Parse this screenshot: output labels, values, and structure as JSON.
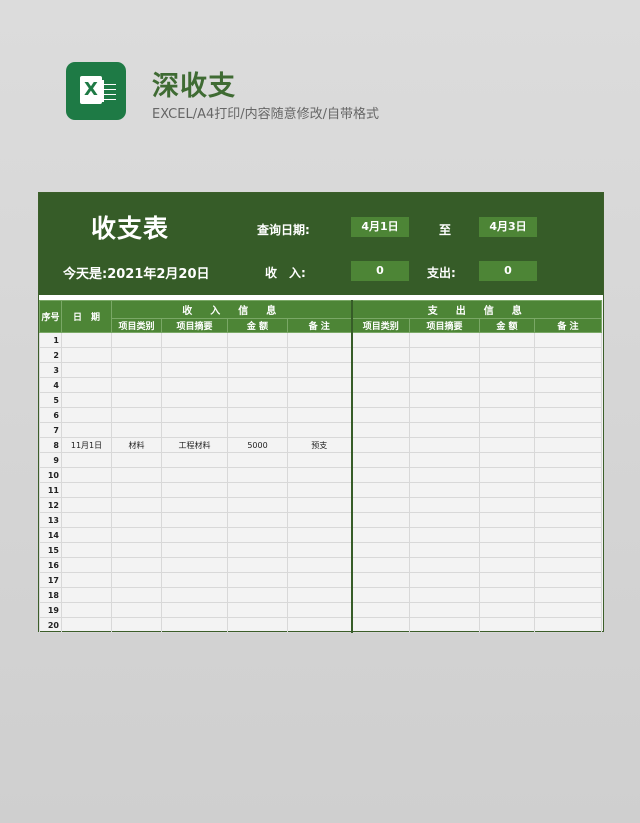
{
  "page": {
    "title": "深收支",
    "subtitle": "EXCEL/A4打印/内容随意修改/自带格式",
    "logo_letter": "X"
  },
  "sheet": {
    "heading": "收支表",
    "query_label": "查询日期:",
    "start_date": "4月1日",
    "to_label": "至",
    "end_date": "4月3日",
    "today_label": "今天是:2021年2月20日",
    "income_label": "收　入:",
    "income_value": "0",
    "expense_label": "支出:",
    "expense_value": "0",
    "table": {
      "col_seq": "序号",
      "col_date": "日　期",
      "income_group": "收　入　信　息",
      "expense_group": "支　出　信　息",
      "income_cols": [
        "项目类别",
        "项目摘要",
        "金 额",
        "备 注"
      ],
      "expense_cols": [
        "项目类别",
        "项目摘要",
        "金 额",
        "备 注"
      ],
      "rows": [
        {
          "n": "1",
          "date": "",
          "cat": "",
          "sum": "",
          "amt": "",
          "note": ""
        },
        {
          "n": "2",
          "date": "",
          "cat": "",
          "sum": "",
          "amt": "",
          "note": ""
        },
        {
          "n": "3",
          "date": "",
          "cat": "",
          "sum": "",
          "amt": "",
          "note": ""
        },
        {
          "n": "4",
          "date": "",
          "cat": "",
          "sum": "",
          "amt": "",
          "note": ""
        },
        {
          "n": "5",
          "date": "",
          "cat": "",
          "sum": "",
          "amt": "",
          "note": ""
        },
        {
          "n": "6",
          "date": "",
          "cat": "",
          "sum": "",
          "amt": "",
          "note": ""
        },
        {
          "n": "7",
          "date": "",
          "cat": "",
          "sum": "",
          "amt": "",
          "note": ""
        },
        {
          "n": "8",
          "date": "11月1日",
          "cat": "材料",
          "sum": "工程材料",
          "amt": "5000",
          "note": "预支"
        },
        {
          "n": "9",
          "date": "",
          "cat": "",
          "sum": "",
          "amt": "",
          "note": ""
        },
        {
          "n": "10",
          "date": "",
          "cat": "",
          "sum": "",
          "amt": "",
          "note": ""
        },
        {
          "n": "11",
          "date": "",
          "cat": "",
          "sum": "",
          "amt": "",
          "note": ""
        },
        {
          "n": "12",
          "date": "",
          "cat": "",
          "sum": "",
          "amt": "",
          "note": ""
        },
        {
          "n": "13",
          "date": "",
          "cat": "",
          "sum": "",
          "amt": "",
          "note": ""
        },
        {
          "n": "14",
          "date": "",
          "cat": "",
          "sum": "",
          "amt": "",
          "note": ""
        },
        {
          "n": "15",
          "date": "",
          "cat": "",
          "sum": "",
          "amt": "",
          "note": ""
        },
        {
          "n": "16",
          "date": "",
          "cat": "",
          "sum": "",
          "amt": "",
          "note": ""
        },
        {
          "n": "17",
          "date": "",
          "cat": "",
          "sum": "",
          "amt": "",
          "note": ""
        },
        {
          "n": "18",
          "date": "",
          "cat": "",
          "sum": "",
          "amt": "",
          "note": ""
        },
        {
          "n": "19",
          "date": "",
          "cat": "",
          "sum": "",
          "amt": "",
          "note": ""
        },
        {
          "n": "20",
          "date": "",
          "cat": "",
          "sum": "",
          "amt": "",
          "note": ""
        }
      ]
    }
  },
  "colors": {
    "header_bg": "#365c28",
    "accent": "#4d8536",
    "title": "#3f6b33"
  }
}
